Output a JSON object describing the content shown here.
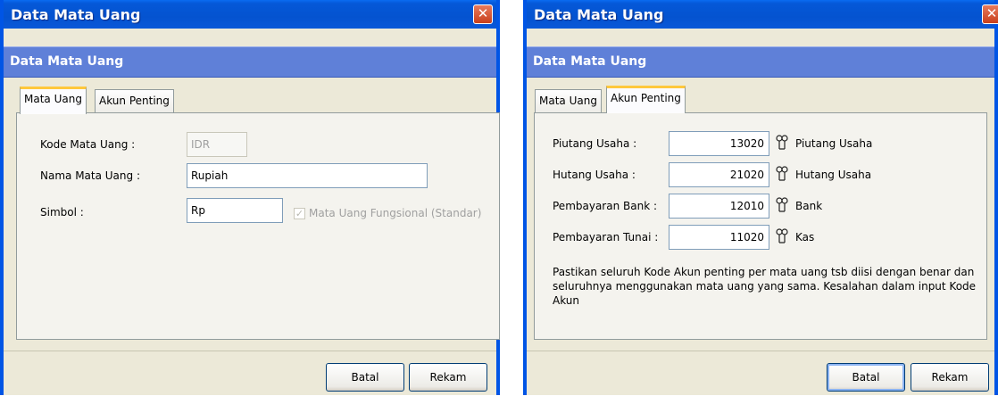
{
  "dialog1": {
    "title": "Data Mata Uang",
    "close_icon": "✕",
    "header": "Data Mata Uang",
    "tabs": [
      "Mata Uang",
      "Akun Penting"
    ],
    "fields": {
      "kode_label": "Kode Mata Uang :",
      "kode_value": "IDR",
      "nama_label": "Nama Mata Uang :",
      "nama_value": "Rupiah",
      "simbol_label": "Simbol :",
      "simbol_value": "Rp"
    },
    "checkbox_label": "Mata Uang Fungsional (Standar)",
    "checkbox_checked": true,
    "buttons": {
      "batal": "Batal",
      "rekam": "Rekam"
    }
  },
  "dialog2": {
    "title": "Data Mata Uang",
    "close_icon": "✕",
    "header": "Data Mata Uang",
    "tabs": [
      "Mata Uang",
      "Akun Penting"
    ],
    "accounts": [
      {
        "label": "Piutang Usaha :",
        "code": "13020",
        "name": "Piutang Usaha"
      },
      {
        "label": "Hutang Usaha :",
        "code": "21020",
        "name": "Hutang Usaha"
      },
      {
        "label": "Pembayaran Bank :",
        "code": "12010",
        "name": "Bank"
      },
      {
        "label": "Pembayaran Tunai :",
        "code": "11020",
        "name": "Kas"
      }
    ],
    "lookup_icon": "binoculars-icon",
    "note": "Pastikan seluruh Kode Akun penting per mata uang tsb diisi dengan benar dan seluruhnya menggunakan mata uang yang sama. Kesalahan dalam input Kode Akun",
    "buttons": {
      "batal": "Batal",
      "rekam": "Rekam"
    }
  },
  "colors": {
    "titlebar": "#0453d0",
    "header_band": "#5f80d8",
    "dialog_bg": "#ece9d8",
    "active_tab_accent": "#ffc83c"
  }
}
